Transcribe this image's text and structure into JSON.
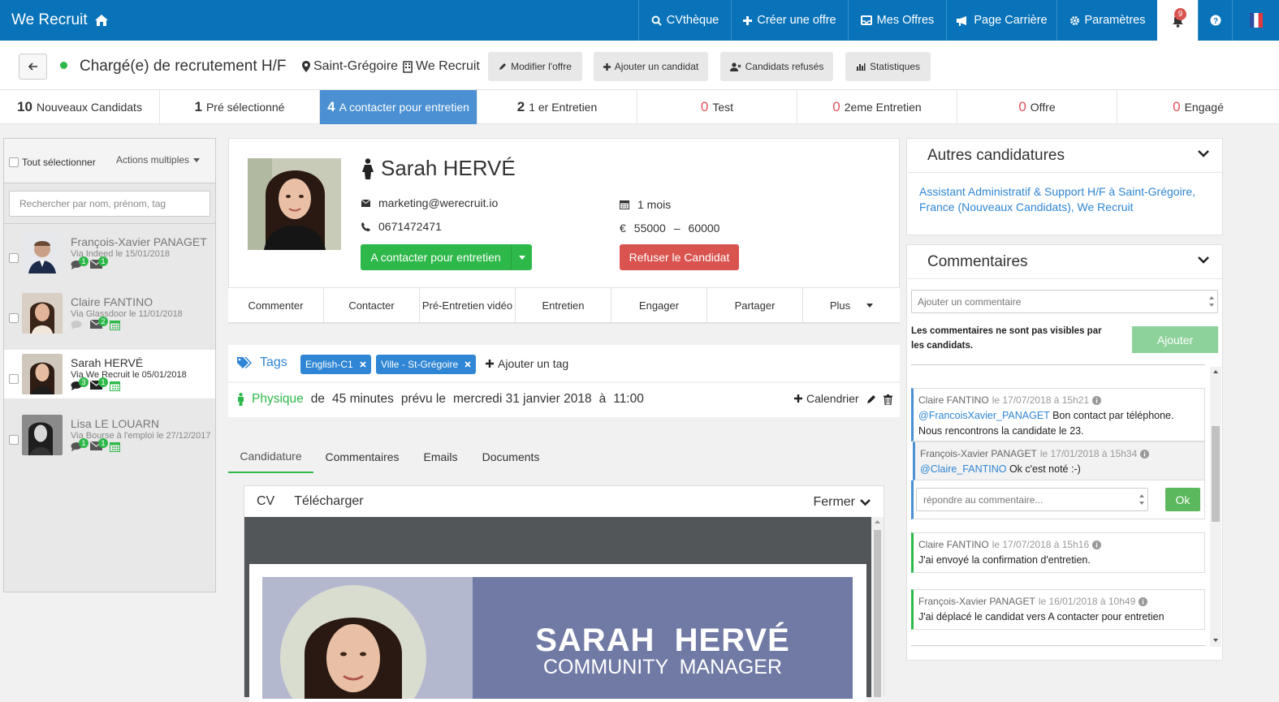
{
  "app": {
    "name": "We Recruit"
  },
  "nav": {
    "cvtheque": "CVthèque",
    "create_offer": "Créer une offre",
    "my_offers": "Mes Offres",
    "career_page": "Page Carrière",
    "settings": "Paramètres",
    "notif_count": "9"
  },
  "job": {
    "title": "Chargé(e) de recrutement H/F",
    "location": "Saint-Grégoire",
    "company": "We Recruit",
    "buttons": {
      "edit": "Modifier l'offre",
      "add": "Ajouter un candidat",
      "refused": "Candidats refusés",
      "stats": "Statistiques"
    }
  },
  "stages": [
    {
      "count": "10",
      "label": "Nouveaux Candidats"
    },
    {
      "count": "1",
      "label": "Pré sélectionné"
    },
    {
      "count": "4",
      "label": "A contacter pour entretien"
    },
    {
      "count": "2",
      "label": "1 er Entretien"
    },
    {
      "count": "0",
      "label": "Test"
    },
    {
      "count": "0",
      "label": "2eme Entretien"
    },
    {
      "count": "0",
      "label": "Offre"
    },
    {
      "count": "0",
      "label": "Engagé"
    }
  ],
  "sidebar": {
    "select_all": "Tout sélectionner",
    "bulk_actions": "Actions multiples",
    "search_placeholder": "Rechercher par nom, prénom, tag",
    "candidates": [
      {
        "name": "François-Xavier PANAGET",
        "via": "Via Indeed le 15/01/2018",
        "b1": "1",
        "b2": "1"
      },
      {
        "name": "Claire FANTINO",
        "via": "Via Glassdoor le 11/01/2018",
        "b1": "",
        "b2": "2"
      },
      {
        "name": "Sarah HERVÉ",
        "via": "Via We Recruit le 05/01/2018",
        "b1": "3",
        "b2": "1"
      },
      {
        "name": "Lisa LE LOUARN",
        "via": "Via Bourse à l'emploi le 27/12/2017",
        "b1": "1",
        "b2": "1"
      }
    ]
  },
  "candidate": {
    "name": "Sarah HERVÉ",
    "email": "marketing@werecruit.io",
    "phone": "0671472471",
    "availability": "1 mois",
    "salary_symbol": "€",
    "salary_min": "55000",
    "salary_sep": "–",
    "salary_max": "60000",
    "stage_button": "A contacter pour entretien",
    "refuse_button": "Refuser le Candidat"
  },
  "actions": [
    "Commenter",
    "Contacter",
    "Pré-Entretien vidéo",
    "Entretien",
    "Engager",
    "Partager",
    "Plus"
  ],
  "tags": {
    "label": "Tags",
    "items": [
      "English-C1",
      "Ville - St-Grégoire"
    ],
    "add": "Ajouter un tag"
  },
  "interview": {
    "type": "Physique",
    "de": "de",
    "duration": "45 minutes",
    "prevu": "prévu le",
    "date": "mercredi 31 janvier 2018",
    "a": "à",
    "time": "11:00",
    "calendar": "Calendrier"
  },
  "tabs": [
    "Candidature",
    "Commentaires",
    "Emails",
    "Documents"
  ],
  "cv": {
    "label": "CV",
    "download": "Télécharger",
    "close": "Fermer",
    "doc_name": "SARAH  HERVÉ",
    "doc_role": "COMMUNITY  MANAGER"
  },
  "other_apps": {
    "title": "Autres candidatures",
    "link": "Assistant Administratif & Support H/F à Saint-Grégoire, France (Nouveaux Candidats), We Recruit"
  },
  "comments": {
    "title": "Commentaires",
    "placeholder": "Ajouter un commentaire",
    "notice": "Les commentaires ne sont pas visibles par les candidats.",
    "add": "Ajouter",
    "reply_placeholder": "répondre au commentaire...",
    "ok": "Ok",
    "items": [
      {
        "author": "Claire FANTINO",
        "date": "le 17/07/2018 à 15h21",
        "mention": "@FrancoisXavier_PANAGET",
        "text": " Bon contact par téléphone. Nous rencontrons la candidate le 23."
      },
      {
        "author": "François-Xavier PANAGET",
        "date": "le 17/01/2018 à 15h34",
        "mention": "@Claire_FANTINO",
        "text": " Ok c'est noté :-)"
      },
      {
        "author": "Claire FANTINO",
        "date": "le 17/07/2018 à 15h16",
        "mention": "",
        "text": "J'ai envoyé la confirmation d'entretien."
      },
      {
        "author": "François-Xavier PANAGET",
        "date": "le 16/01/2018 à 10h49",
        "mention": "",
        "text": "J'ai déplacé le candidat vers A contacter pour entretien"
      }
    ]
  },
  "colors": {
    "primary": "#0873b9",
    "green": "#2eb84a",
    "red": "#d9534f",
    "tag": "#2f86d4",
    "active_stage": "#4a90d2"
  }
}
